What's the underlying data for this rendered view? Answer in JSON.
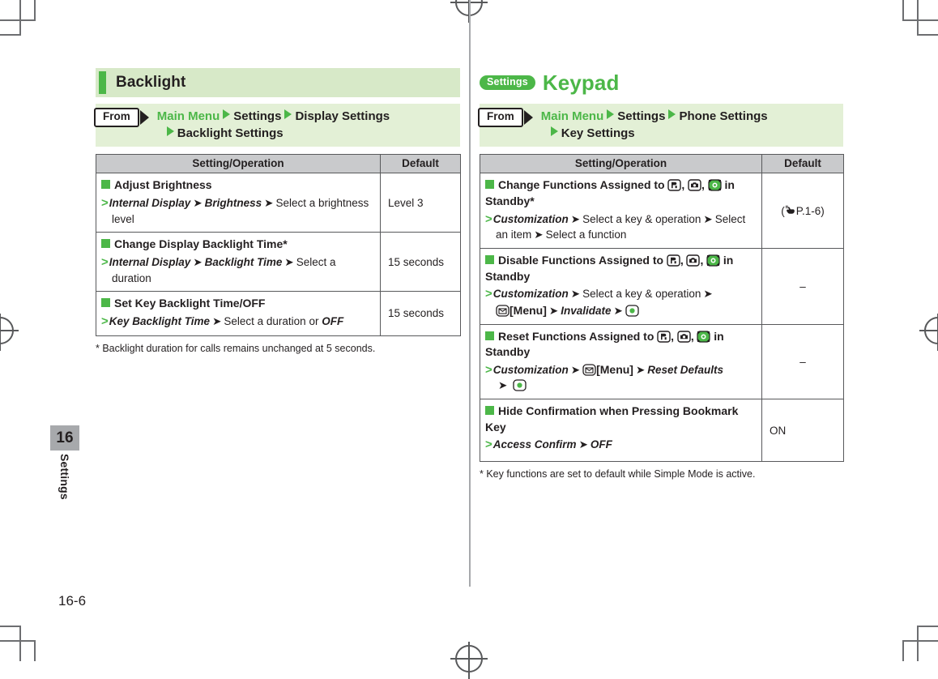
{
  "page": {
    "folio": "16-6",
    "chapter_number": "16",
    "chapter_label": "Settings"
  },
  "left_section": {
    "title": "Backlight",
    "from": {
      "label": "From",
      "crumbs": [
        "Main Menu",
        "Settings",
        "Display Settings",
        "Backlight Settings"
      ]
    },
    "table": {
      "headers": [
        "Setting/Operation",
        "Default"
      ],
      "rows": [
        {
          "title": "Adjust Brightness",
          "operation": "Internal Display ➔ Brightness ➔ Select a brightness level",
          "op_bold_italic": [
            "Internal Display",
            "Brightness"
          ],
          "op_plain": "Select a brightness level",
          "default": "Level 3"
        },
        {
          "title": "Change Display Backlight Time*",
          "operation": "Internal Display ➔ Backlight Time ➔ Select a duration",
          "op_bold_italic": [
            "Internal Display",
            "Backlight Time"
          ],
          "op_plain": "Select a duration",
          "default": "15 seconds"
        },
        {
          "title": "Set Key Backlight Time/OFF",
          "operation": "Key Backlight Time ➔ Select a duration or OFF",
          "op_bold_italic": [
            "Key Backlight Time",
            "OFF"
          ],
          "op_plain": "Select a duration or",
          "default": "15 seconds"
        }
      ]
    },
    "footnote": "* Backlight duration for calls remains unchanged at 5 seconds."
  },
  "right_section": {
    "badge": "Settings",
    "title": "Keypad",
    "from": {
      "label": "From",
      "crumbs": [
        "Main Menu",
        "Settings",
        "Phone Settings",
        "Key Settings"
      ]
    },
    "table": {
      "headers": [
        "Setting/Operation",
        "Default"
      ],
      "rows": [
        {
          "title_pre": "Change Functions Assigned to",
          "title_post": "in Standby*",
          "icons": [
            "memo-key-icon",
            "camera-key-icon",
            "multi-key-icon"
          ],
          "op_1": "Customization",
          "op_2": "Select a key & operation",
          "op_3": "Select an item",
          "op_4": "Select a function",
          "default": "(☞ P.1-6)",
          "default_ref_text": "P.1-6"
        },
        {
          "title_pre": "Disable Functions Assigned to",
          "title_post": "in Standby",
          "icons": [
            "memo-key-icon",
            "camera-key-icon",
            "multi-key-icon"
          ],
          "op_1": "Customization",
          "op_2": "Select a key & operation",
          "op_3": "[Menu]",
          "op_4": "Invalidate",
          "op_5": "center-key-icon",
          "default": "–"
        },
        {
          "title_pre": "Reset Functions Assigned to",
          "title_post": "in Standby",
          "icons": [
            "memo-key-icon",
            "camera-key-icon",
            "multi-key-icon"
          ],
          "op_1": "Customization",
          "op_3": "[Menu]",
          "op_4": "Reset Defaults",
          "op_5": "center-key-icon",
          "default": "–"
        },
        {
          "title": "Hide Confirmation when Pressing Bookmark Key",
          "op_1": "Access Confirm",
          "op_4": "OFF",
          "default": "ON"
        }
      ]
    },
    "footnote": "* Key functions are set to default while Simple Mode is active."
  },
  "colors": {
    "accent_green": "#4cb748",
    "title_band": "#d7e9c8",
    "from_band": "#e3f0d6",
    "table_header": "#c9cacc",
    "rule": "#58595b",
    "chapter_tab": "#a7a9ac"
  }
}
